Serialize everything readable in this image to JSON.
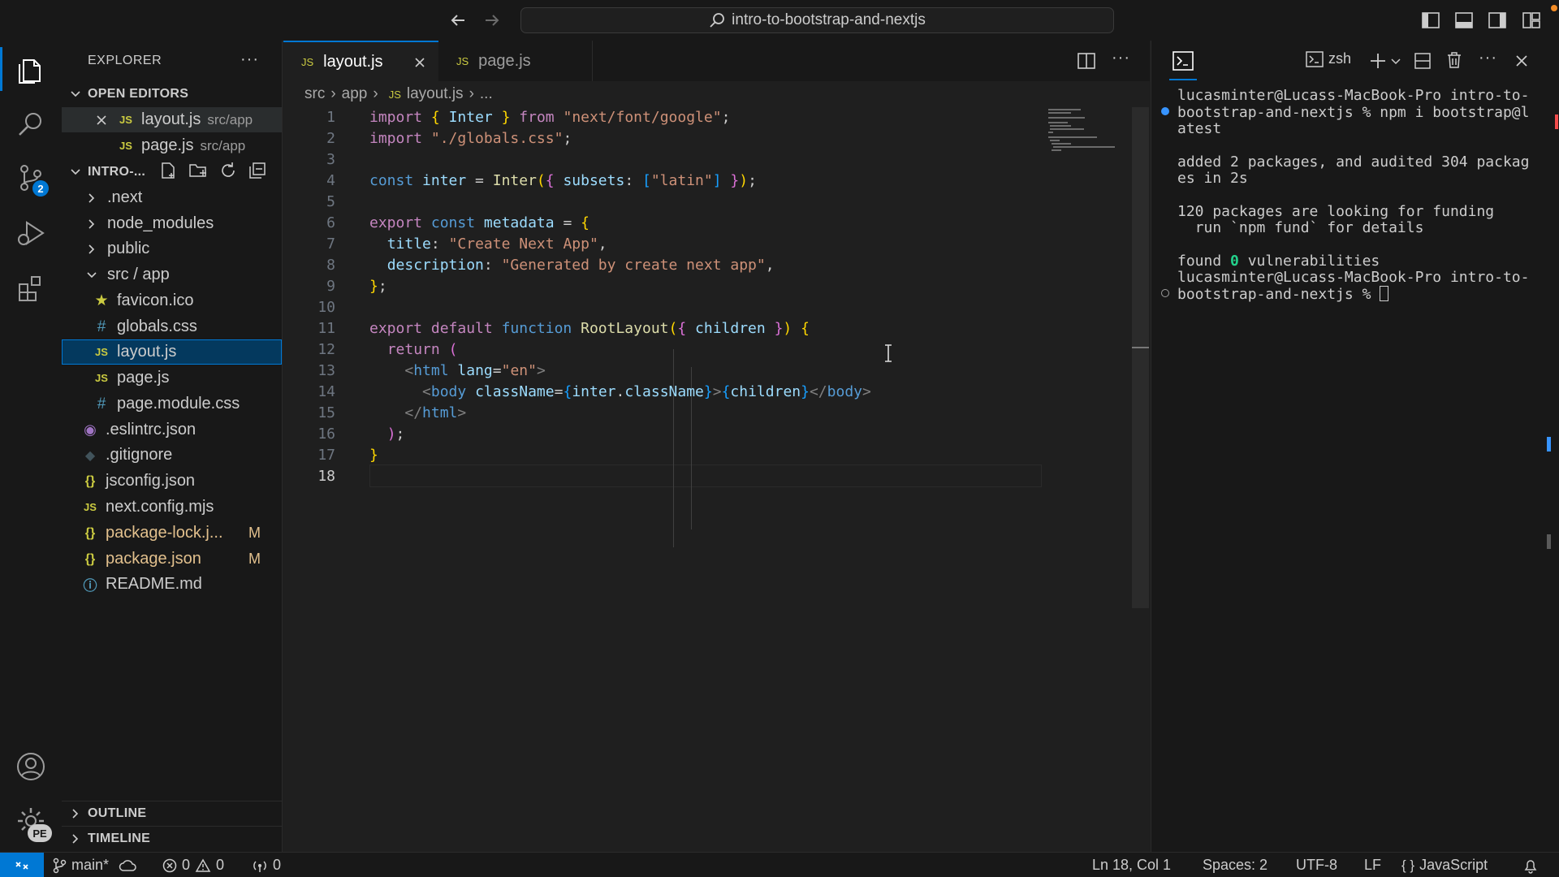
{
  "window": {
    "search_text": "intro-to-bootstrap-and-nextjs"
  },
  "sidebar": {
    "title": "EXPLORER",
    "more": "···",
    "open_editors": {
      "label": "OPEN EDITORS",
      "items": [
        {
          "name": "layout.js",
          "path": "src/app"
        },
        {
          "name": "page.js",
          "path": "src/app"
        }
      ]
    },
    "folder": {
      "label": "INTRO-...",
      "items": [
        {
          "name": ".next"
        },
        {
          "name": "node_modules"
        },
        {
          "name": "public"
        },
        {
          "name": "src / app"
        },
        {
          "name": "favicon.ico"
        },
        {
          "name": "globals.css"
        },
        {
          "name": "layout.js"
        },
        {
          "name": "page.js"
        },
        {
          "name": "page.module.css"
        },
        {
          "name": ".eslintrc.json"
        },
        {
          "name": ".gitignore"
        },
        {
          "name": "jsconfig.json"
        },
        {
          "name": "next.config.mjs"
        },
        {
          "name": "package-lock.j...",
          "status": "M"
        },
        {
          "name": "package.json",
          "status": "M"
        },
        {
          "name": "README.md"
        }
      ]
    },
    "outline": "OUTLINE",
    "timeline": "TIMELINE"
  },
  "activity": {
    "scm_badge": "2",
    "accounts_badge": "PE"
  },
  "editor": {
    "tabs": [
      {
        "label": "layout.js",
        "icon": "JS"
      },
      {
        "label": "page.js",
        "icon": "JS"
      }
    ],
    "breadcrumb": [
      "src",
      "app",
      "layout.js",
      "..."
    ],
    "line_numbers": [
      "1",
      "2",
      "3",
      "4",
      "5",
      "6",
      "7",
      "8",
      "9",
      "10",
      "11",
      "12",
      "13",
      "14",
      "15",
      "16",
      "17",
      "18"
    ]
  },
  "terminal": {
    "shell": "zsh",
    "lines": [
      "lucasminter@Lucass-MacBook-Pro intro-to-",
      "bootstrap-and-nextjs % npm i bootstrap@l",
      "atest",
      "",
      "added 2 packages, and audited 304 packag",
      "es in 2s",
      "",
      "120 packages are looking for funding",
      "  run `npm fund` for details",
      "",
      "found 0 vulnerabilities",
      "lucasminter@Lucass-MacBook-Pro intro-to-",
      "bootstrap-and-nextjs % "
    ]
  },
  "statusbar": {
    "branch": "main*",
    "errors": "0",
    "warnings": "0",
    "ports": "0",
    "position": "Ln 18, Col 1",
    "spaces": "Spaces: 2",
    "encoding": "UTF-8",
    "eol": "LF",
    "language": "JavaScript"
  }
}
